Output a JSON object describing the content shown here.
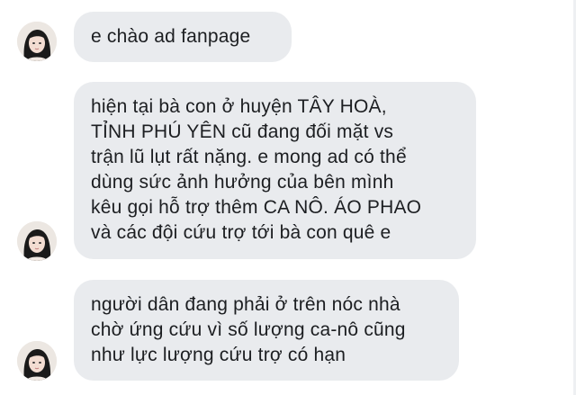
{
  "conversation": {
    "messages": [
      {
        "lines": [
          "e chào ad fanpage"
        ]
      },
      {
        "lines": [
          "hiện tại bà con ở huyện TÂY HOÀ,",
          "TỈNH PHÚ YÊN cũ đang đối mặt vs",
          "trận lũ lụt rất nặng. e mong ad có thể",
          "dùng sức ảnh hưởng của bên mình",
          "kêu gọi hỗ trợ thêm CA NÔ. ÁO PHAO",
          "và các đội cứu trợ tới bà con quê e"
        ]
      },
      {
        "lines": [
          "người dân đang phải ở trên nóc nhà",
          "chờ ứng cứu vì số lượng ca-nô cũng",
          "như lực lượng cứu trợ có hạn"
        ]
      }
    ]
  },
  "colors": {
    "bubble_bg": "#e9ebee",
    "text": "#1c1e21",
    "background": "#ffffff"
  },
  "icons": {
    "avatar": "user-avatar-photo"
  }
}
